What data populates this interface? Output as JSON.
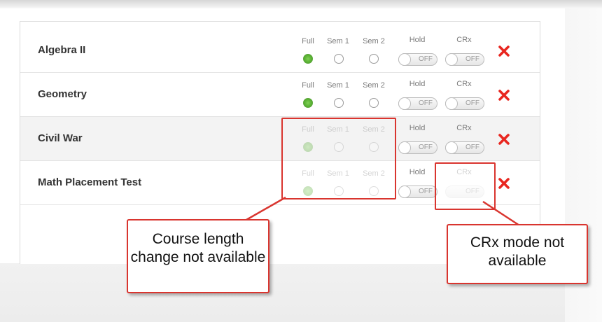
{
  "option_labels": {
    "full": "Full",
    "sem1": "Sem 1",
    "sem2": "Sem 2",
    "hold": "Hold",
    "crx": "CRx"
  },
  "toggle_off_text": "OFF",
  "courses": [
    {
      "name": "Algebra II",
      "length_selected": "Full",
      "length_enabled": true,
      "hold": "OFF",
      "crx": "OFF",
      "crx_enabled": true
    },
    {
      "name": "Geometry",
      "length_selected": "Full",
      "length_enabled": true,
      "hold": "OFF",
      "crx": "OFF",
      "crx_enabled": true
    },
    {
      "name": "Civil War",
      "length_selected": "Full",
      "length_enabled": false,
      "hold": "OFF",
      "crx": "OFF",
      "crx_enabled": true
    },
    {
      "name": "Math Placement Test",
      "length_selected": "Full",
      "length_enabled": false,
      "hold": "OFF",
      "crx": "OFF",
      "crx_enabled": false
    }
  ],
  "callouts": {
    "course_length": "Course length change not available",
    "crx_mode": "CRx mode not available"
  },
  "colors": {
    "selected_radio": "#5cb335",
    "delete_icon": "#e8261f",
    "callout_border": "#d9352f"
  },
  "icons": [
    "delete-icon"
  ]
}
